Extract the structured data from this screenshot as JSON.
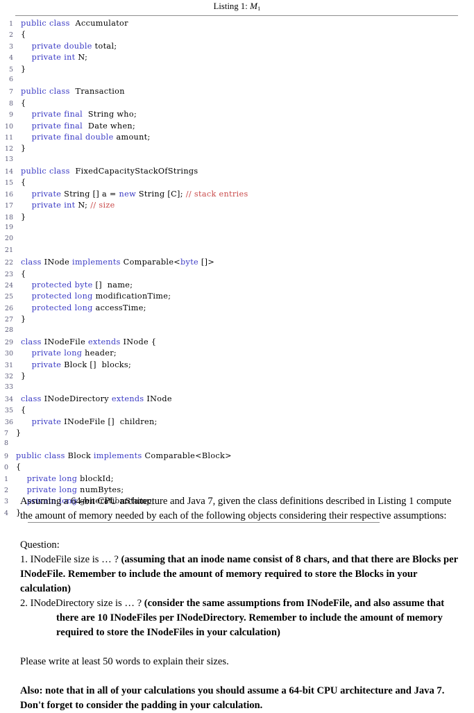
{
  "listing": {
    "caption_prefix": "Listing 1:",
    "caption_symbol": "M",
    "caption_subscript": "1",
    "syntax_colors": {
      "keyword": "#3a3ac4",
      "comment": "#c94a4a",
      "identifier": "#000000",
      "lineno": "#5b5b7a"
    },
    "lines": [
      {
        "n": "1",
        "clipped": false,
        "tokens": [
          {
            "t": "public",
            "c": "kw"
          },
          {
            "t": " ",
            "c": "id"
          },
          {
            "t": "class",
            "c": "kw"
          },
          {
            "t": "  Accumulator",
            "c": "id"
          }
        ]
      },
      {
        "n": "2",
        "clipped": false,
        "tokens": [
          {
            "t": "{",
            "c": "id"
          }
        ]
      },
      {
        "n": "3",
        "clipped": false,
        "tokens": [
          {
            "t": "    ",
            "c": "id"
          },
          {
            "t": "private",
            "c": "kw"
          },
          {
            "t": " ",
            "c": "id"
          },
          {
            "t": "double",
            "c": "kw"
          },
          {
            "t": " total;",
            "c": "id"
          }
        ]
      },
      {
        "n": "4",
        "clipped": false,
        "tokens": [
          {
            "t": "    ",
            "c": "id"
          },
          {
            "t": "private",
            "c": "kw"
          },
          {
            "t": " ",
            "c": "id"
          },
          {
            "t": "int",
            "c": "kw"
          },
          {
            "t": " N;",
            "c": "id"
          }
        ]
      },
      {
        "n": "5",
        "clipped": false,
        "tokens": [
          {
            "t": "}",
            "c": "id"
          }
        ]
      },
      {
        "n": "6",
        "clipped": false,
        "tokens": []
      },
      {
        "n": "7",
        "clipped": false,
        "tokens": [
          {
            "t": "public",
            "c": "kw"
          },
          {
            "t": " ",
            "c": "id"
          },
          {
            "t": "class",
            "c": "kw"
          },
          {
            "t": "  Transaction",
            "c": "id"
          }
        ]
      },
      {
        "n": "8",
        "clipped": false,
        "tokens": [
          {
            "t": "{",
            "c": "id"
          }
        ]
      },
      {
        "n": "9",
        "clipped": false,
        "tokens": [
          {
            "t": "    ",
            "c": "id"
          },
          {
            "t": "private",
            "c": "kw"
          },
          {
            "t": " ",
            "c": "id"
          },
          {
            "t": "final",
            "c": "kw"
          },
          {
            "t": "  String who;",
            "c": "id"
          }
        ]
      },
      {
        "n": "10",
        "clipped": false,
        "tokens": [
          {
            "t": "    ",
            "c": "id"
          },
          {
            "t": "private",
            "c": "kw"
          },
          {
            "t": " ",
            "c": "id"
          },
          {
            "t": "final",
            "c": "kw"
          },
          {
            "t": "  Date when;",
            "c": "id"
          }
        ]
      },
      {
        "n": "11",
        "clipped": false,
        "tokens": [
          {
            "t": "    ",
            "c": "id"
          },
          {
            "t": "private",
            "c": "kw"
          },
          {
            "t": " ",
            "c": "id"
          },
          {
            "t": "final",
            "c": "kw"
          },
          {
            "t": " ",
            "c": "id"
          },
          {
            "t": "double",
            "c": "kw"
          },
          {
            "t": " amount;",
            "c": "id"
          }
        ]
      },
      {
        "n": "12",
        "clipped": false,
        "tokens": [
          {
            "t": "}",
            "c": "id"
          }
        ]
      },
      {
        "n": "13",
        "clipped": false,
        "tokens": []
      },
      {
        "n": "14",
        "clipped": false,
        "tokens": [
          {
            "t": "public",
            "c": "kw"
          },
          {
            "t": " ",
            "c": "id"
          },
          {
            "t": "class",
            "c": "kw"
          },
          {
            "t": "  FixedCapacityStackOfStrings",
            "c": "id"
          }
        ]
      },
      {
        "n": "15",
        "clipped": false,
        "tokens": [
          {
            "t": "{",
            "c": "id"
          }
        ]
      },
      {
        "n": "16",
        "clipped": false,
        "tokens": [
          {
            "t": "    ",
            "c": "id"
          },
          {
            "t": "private",
            "c": "kw"
          },
          {
            "t": " String [] a = ",
            "c": "id"
          },
          {
            "t": "new",
            "c": "kw"
          },
          {
            "t": " String [C]; ",
            "c": "id"
          },
          {
            "t": "// stack entries",
            "c": "cmt"
          }
        ]
      },
      {
        "n": "17",
        "clipped": false,
        "tokens": [
          {
            "t": "    ",
            "c": "id"
          },
          {
            "t": "private",
            "c": "kw"
          },
          {
            "t": " ",
            "c": "id"
          },
          {
            "t": "int",
            "c": "kw"
          },
          {
            "t": " N; ",
            "c": "id"
          },
          {
            "t": "// size",
            "c": "cmt"
          }
        ]
      },
      {
        "n": "18",
        "clipped": false,
        "tokens": [
          {
            "t": "}",
            "c": "id"
          }
        ]
      },
      {
        "n": "19",
        "clipped": false,
        "tokens": []
      },
      {
        "n": "20",
        "clipped": false,
        "tokens": []
      },
      {
        "n": "21",
        "clipped": false,
        "tokens": []
      },
      {
        "n": "22",
        "clipped": false,
        "tokens": [
          {
            "t": "class",
            "c": "kw"
          },
          {
            "t": " INode ",
            "c": "id"
          },
          {
            "t": "implements",
            "c": "kw"
          },
          {
            "t": " Comparable<",
            "c": "id"
          },
          {
            "t": "byte",
            "c": "kw"
          },
          {
            "t": " []>",
            "c": "id"
          }
        ]
      },
      {
        "n": "23",
        "clipped": false,
        "tokens": [
          {
            "t": "{",
            "c": "id"
          }
        ]
      },
      {
        "n": "24",
        "clipped": false,
        "tokens": [
          {
            "t": "    ",
            "c": "id"
          },
          {
            "t": "protected",
            "c": "kw"
          },
          {
            "t": " ",
            "c": "id"
          },
          {
            "t": "byte",
            "c": "kw"
          },
          {
            "t": " []  name;",
            "c": "id"
          }
        ]
      },
      {
        "n": "25",
        "clipped": false,
        "tokens": [
          {
            "t": "    ",
            "c": "id"
          },
          {
            "t": "protected",
            "c": "kw"
          },
          {
            "t": " ",
            "c": "id"
          },
          {
            "t": "long",
            "c": "kw"
          },
          {
            "t": " modificationTime;",
            "c": "id"
          }
        ]
      },
      {
        "n": "26",
        "clipped": false,
        "tokens": [
          {
            "t": "    ",
            "c": "id"
          },
          {
            "t": "protected",
            "c": "kw"
          },
          {
            "t": " ",
            "c": "id"
          },
          {
            "t": "long",
            "c": "kw"
          },
          {
            "t": " accessTime;",
            "c": "id"
          }
        ]
      },
      {
        "n": "27",
        "clipped": false,
        "tokens": [
          {
            "t": "}",
            "c": "id"
          }
        ]
      },
      {
        "n": "28",
        "clipped": false,
        "tokens": []
      },
      {
        "n": "29",
        "clipped": false,
        "tokens": [
          {
            "t": "class",
            "c": "kw"
          },
          {
            "t": " INodeFile ",
            "c": "id"
          },
          {
            "t": "extends",
            "c": "kw"
          },
          {
            "t": " INode {",
            "c": "id"
          }
        ]
      },
      {
        "n": "30",
        "clipped": false,
        "tokens": [
          {
            "t": "    ",
            "c": "id"
          },
          {
            "t": "private",
            "c": "kw"
          },
          {
            "t": " ",
            "c": "id"
          },
          {
            "t": "long",
            "c": "kw"
          },
          {
            "t": " header;",
            "c": "id"
          }
        ]
      },
      {
        "n": "31",
        "clipped": false,
        "tokens": [
          {
            "t": "    ",
            "c": "id"
          },
          {
            "t": "private",
            "c": "kw"
          },
          {
            "t": " Block []  blocks;",
            "c": "id"
          }
        ]
      },
      {
        "n": "32",
        "clipped": false,
        "tokens": [
          {
            "t": "}",
            "c": "id"
          }
        ]
      },
      {
        "n": "33",
        "clipped": false,
        "tokens": []
      },
      {
        "n": "34",
        "clipped": false,
        "tokens": [
          {
            "t": "class",
            "c": "kw"
          },
          {
            "t": " INodeDirectory ",
            "c": "id"
          },
          {
            "t": "extends",
            "c": "kw"
          },
          {
            "t": " INode",
            "c": "id"
          }
        ]
      },
      {
        "n": "35",
        "clipped": false,
        "tokens": [
          {
            "t": "{",
            "c": "id"
          }
        ]
      },
      {
        "n": "36",
        "clipped": false,
        "tokens": [
          {
            "t": "    ",
            "c": "id"
          },
          {
            "t": "private",
            "c": "kw"
          },
          {
            "t": " INodeFile []  children;",
            "c": "id"
          }
        ]
      },
      {
        "n": "7",
        "clipped": true,
        "tokens": [
          {
            "t": "}",
            "c": "id"
          }
        ]
      },
      {
        "n": "8",
        "clipped": true,
        "tokens": []
      },
      {
        "n": "9",
        "clipped": true,
        "tokens": [
          {
            "t": "public",
            "c": "kw"
          },
          {
            "t": " ",
            "c": "id"
          },
          {
            "t": "class",
            "c": "kw"
          },
          {
            "t": " Block ",
            "c": "id"
          },
          {
            "t": "implements",
            "c": "kw"
          },
          {
            "t": " Comparable<Block>",
            "c": "id"
          }
        ]
      },
      {
        "n": "0",
        "clipped": true,
        "tokens": [
          {
            "t": "{",
            "c": "id"
          }
        ]
      },
      {
        "n": "1",
        "clipped": true,
        "tokens": [
          {
            "t": "    ",
            "c": "id"
          },
          {
            "t": "private",
            "c": "kw"
          },
          {
            "t": " ",
            "c": "id"
          },
          {
            "t": "long",
            "c": "kw"
          },
          {
            "t": " blockId;",
            "c": "id"
          }
        ]
      },
      {
        "n": "2",
        "clipped": true,
        "tokens": [
          {
            "t": "    ",
            "c": "id"
          },
          {
            "t": "private",
            "c": "kw"
          },
          {
            "t": " ",
            "c": "id"
          },
          {
            "t": "long",
            "c": "kw"
          },
          {
            "t": " numBytes;",
            "c": "id"
          }
        ]
      },
      {
        "n": "3",
        "clipped": true,
        "tokens": [
          {
            "t": "    ",
            "c": "id"
          },
          {
            "t": "private",
            "c": "kw"
          },
          {
            "t": " ",
            "c": "id"
          },
          {
            "t": "long",
            "c": "kw"
          },
          {
            "t": " generationStamp;",
            "c": "id"
          }
        ]
      },
      {
        "n": "4",
        "clipped": true,
        "tokens": [
          {
            "t": "}",
            "c": "id"
          }
        ]
      }
    ]
  },
  "prose": {
    "intro": "Assuming a 64-bit CPU architecture and Java 7, given the class definitions described in Listing 1 compute the amount of memory needed by each of the following objects considering their respective assumptions:",
    "question_label": "Question:",
    "q1_lead": "1. INodeFile size is … ? ",
    "q1_bold": "(assuming that an inode name consist of 8 chars, and that there are Blocks per INodeFile. Remember to include the amount of memory required to store the Blocks in your calculation)",
    "q2_lead": "2. INodeDirectory size is … ? ",
    "q2_bold": "(consider the same assumptions from INodeFile, and also assume that there are 10 INodeFiles per INodeDirectory. Remember to include the amount of memory required to store the INodeFiles in your  calculation)",
    "word_count_note": "Please write at least 50 words to explain their sizes.",
    "final_note": "Also: note that in all of your calculations you should assume a 64-bit CPU architecture and Java 7. Don't forget to consider the padding in your calculation."
  }
}
